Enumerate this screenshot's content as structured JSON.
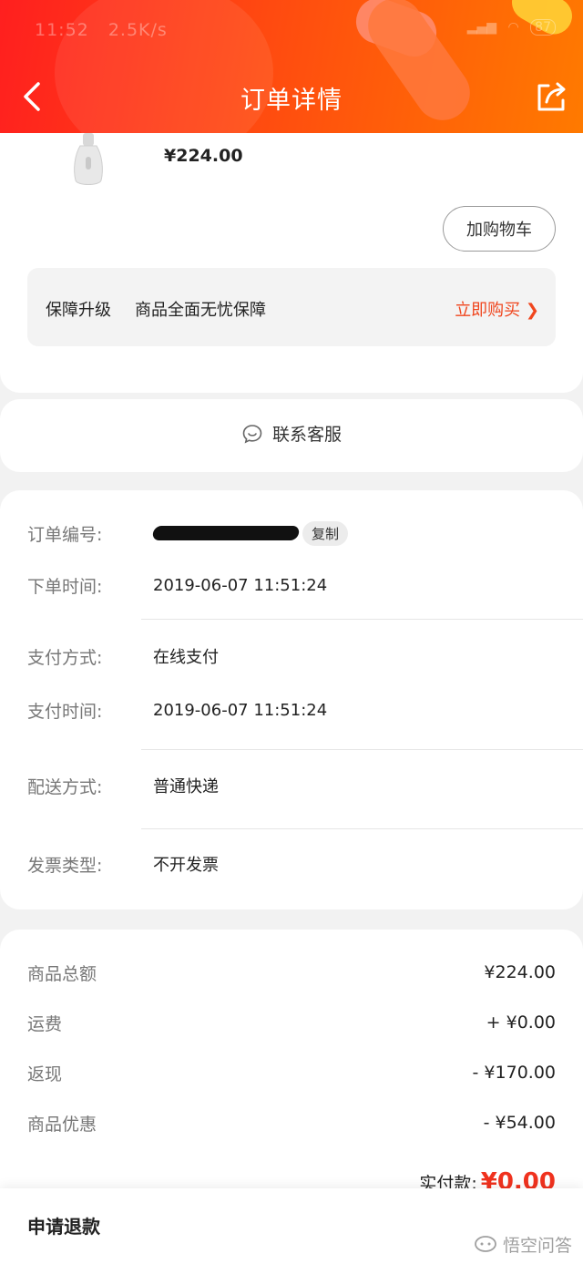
{
  "status_bar": {
    "time": "11:52",
    "speed": "2.5K/s",
    "battery": "87"
  },
  "header": {
    "title": "订单详情"
  },
  "product": {
    "price": "¥224.00",
    "add_cart_label": "加购物车"
  },
  "guarantee": {
    "tag": "保障升级",
    "desc": "商品全面无忧保障",
    "buy_label": "立即购买 ❯"
  },
  "contact": {
    "label": "联系客服"
  },
  "order_info": {
    "order_no_label": "订单编号:",
    "copy_label": "复制",
    "order_time_label": "下单时间:",
    "order_time": "2019-06-07 11:51:24",
    "pay_method_label": "支付方式:",
    "pay_method": "在线支付",
    "pay_time_label": "支付时间:",
    "pay_time": "2019-06-07 11:51:24",
    "delivery_label": "配送方式:",
    "delivery": "普通快递",
    "invoice_label": "发票类型:",
    "invoice": "不开发票"
  },
  "amounts": {
    "rows": [
      {
        "label": "商品总额",
        "value": "¥224.00"
      },
      {
        "label": "运费",
        "value": "+ ¥0.00"
      },
      {
        "label": "返现",
        "value": "- ¥170.00"
      },
      {
        "label": "商品优惠",
        "value": "- ¥54.00"
      }
    ],
    "paid_label": "实付款:",
    "paid_value": "¥0.00"
  },
  "bottom": {
    "refund_label": "申请退款",
    "watermark": "悟空问答"
  },
  "colors": {
    "accent": "#f0461e",
    "header_start": "#ff1f1f",
    "header_end": "#ff7a00"
  }
}
